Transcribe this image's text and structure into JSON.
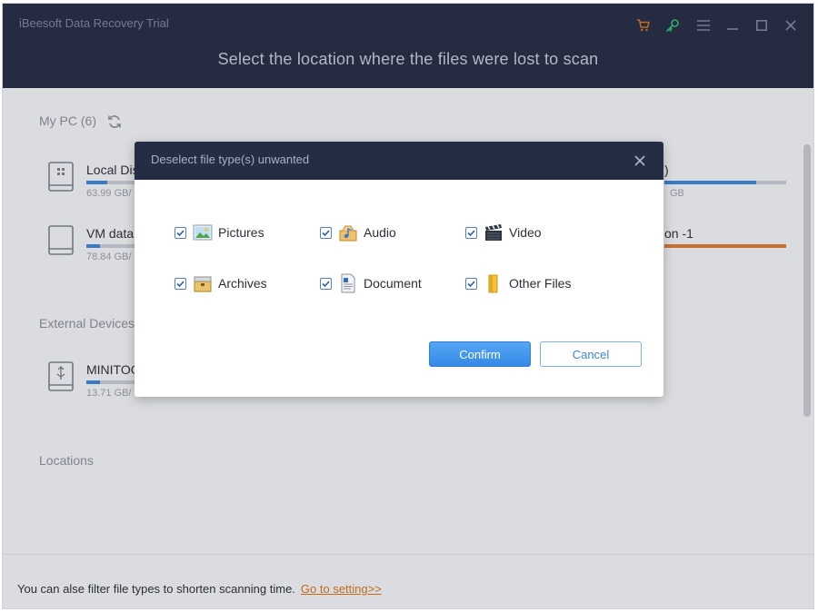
{
  "window": {
    "title": "iBeesoft Data Recovery Trial"
  },
  "header": {
    "headline": "Select the location where the files were lost to scan"
  },
  "toolbar": {
    "icons": [
      "cart-icon",
      "key-icon",
      "menu-icon",
      "minimize-icon",
      "maximize-icon",
      "close-icon"
    ],
    "colors": {
      "cart": "#d7751a",
      "key": "#2fc07a",
      "other": "#7d879e"
    }
  },
  "sections": {
    "my_pc": "My PC (6)",
    "external": "External Devices (",
    "locations": "Locations"
  },
  "drives": [
    {
      "name": "Local Dis",
      "size": "63.99 GB/",
      "fill": 0.15,
      "color": "#3c86d8"
    },
    {
      "name": "VM data",
      "size": "78.84 GB/",
      "fill": 0.1,
      "color": "#3c86d8"
    },
    {
      "name": "MINITOO",
      "size": "13.71 GB/",
      "fill": 0.1,
      "color": "#3c86d8"
    },
    {
      "name": ")",
      "size": "GB",
      "fill": 0.75,
      "color": "#3c86d8"
    },
    {
      "name": "on -1",
      "size": "",
      "fill": 1.0,
      "color": "#e07a30"
    }
  ],
  "dialog": {
    "title": "Deselect file type(s) unwanted",
    "file_types": [
      {
        "label": "Pictures",
        "icon": "picture-icon",
        "checked": true
      },
      {
        "label": "Audio",
        "icon": "audio-icon",
        "checked": true
      },
      {
        "label": "Video",
        "icon": "video-icon",
        "checked": true
      },
      {
        "label": "Archives",
        "icon": "archive-icon",
        "checked": true
      },
      {
        "label": "Document",
        "icon": "document-icon",
        "checked": true
      },
      {
        "label": "Other Files",
        "icon": "folder-icon",
        "checked": true
      }
    ],
    "confirm_label": "Confirm",
    "cancel_label": "Cancel"
  },
  "footer": {
    "text": "You can alse filter file types to shorten scanning time.",
    "link": "Go to setting>>"
  }
}
